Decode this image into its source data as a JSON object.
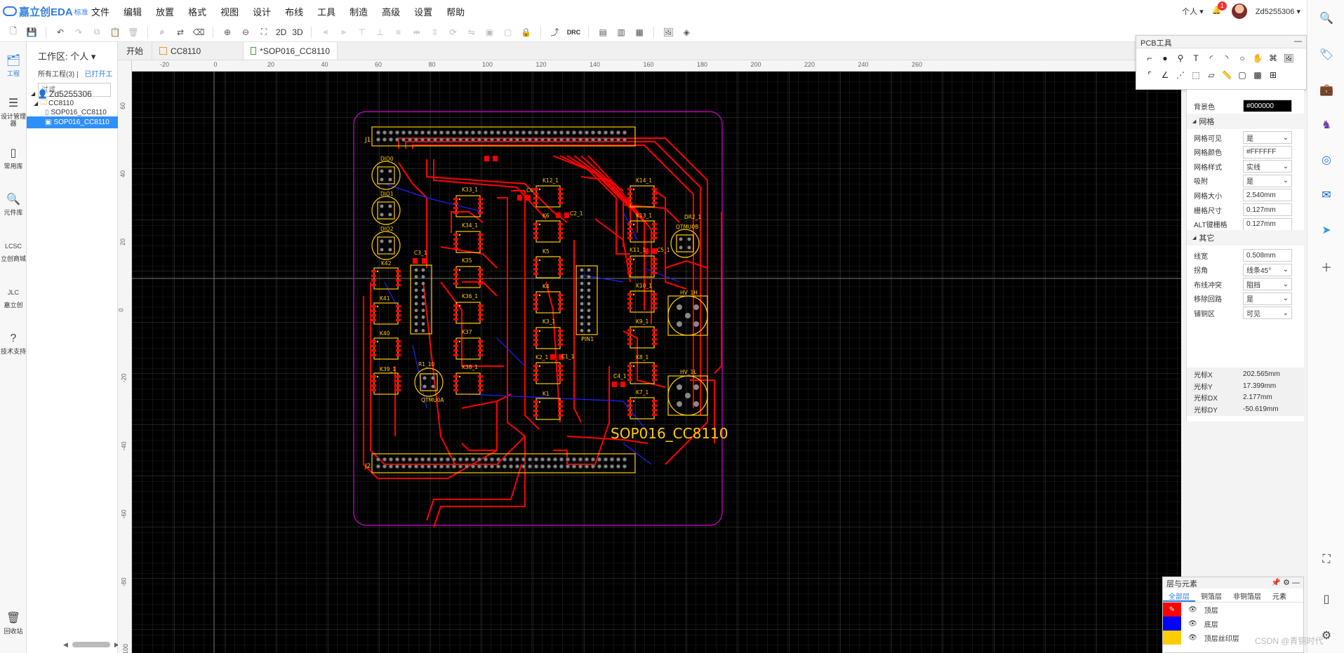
{
  "app": {
    "brand": "嘉立创EDA",
    "edition": "标准"
  },
  "menu": [
    "文件",
    "编辑",
    "放置",
    "格式",
    "视图",
    "设计",
    "布线",
    "工具",
    "制造",
    "高级",
    "设置",
    "帮助"
  ],
  "topright": {
    "mode": "个人",
    "notifications": "1",
    "username": "Zd5255306"
  },
  "toolbar": {
    "view2d": "2D",
    "view3d": "3D",
    "drc": "DRC"
  },
  "leftbar": [
    {
      "label": "工程",
      "icon": "folder-icon"
    },
    {
      "label": "设计管理器",
      "icon": "tree-icon"
    },
    {
      "label": "常用库",
      "icon": "chip-icon"
    },
    {
      "label": "元件库",
      "icon": "search-icon"
    },
    {
      "label": "立创商城",
      "icon": "lcsc-icon"
    },
    {
      "label": "嘉立创",
      "icon": "jlc-icon"
    },
    {
      "label": "技术支持",
      "icon": "help-icon"
    }
  ],
  "recycle": "回收站",
  "project": {
    "workspace": "工作区: 个人",
    "all_projects": "所有工程(3)",
    "opened": "已打开工",
    "filter_placeholder": "过滤",
    "tree": {
      "user": "Zd5255306",
      "project": "CC8110",
      "file1": "SOP016_CC8110",
      "file2": "SOP016_CC8110"
    }
  },
  "tabs": {
    "start": "开始",
    "t1": "CC8110",
    "t2": "*SOP016_CC8110"
  },
  "ruler": {
    "top": [
      "-20",
      "0",
      "20",
      "40",
      "60",
      "80",
      "100",
      "120",
      "140",
      "160",
      "180",
      "200",
      "220",
      "240",
      "260"
    ],
    "left": [
      "60",
      "40",
      "20",
      "0",
      "-20",
      "-40",
      "-60",
      "-80",
      "-100"
    ]
  },
  "pcb_tools": {
    "title": "PCB工具"
  },
  "properties": {
    "bg_label": "背景色",
    "bg_value": "#000000",
    "grid_section": "网格",
    "rows": [
      {
        "label": "网格可见",
        "value": "是"
      },
      {
        "label": "网格颜色",
        "value": "#FFFFFF"
      },
      {
        "label": "网格样式",
        "value": "实线"
      },
      {
        "label": "吸附",
        "value": "是"
      },
      {
        "label": "网格大小",
        "value": "2.540mm"
      },
      {
        "label": "栅格尺寸",
        "value": "0.127mm"
      },
      {
        "label": "ALT键栅格",
        "value": "0.127mm"
      }
    ],
    "other_section": "其它",
    "other_rows": [
      {
        "label": "线宽",
        "value": "0.508mm"
      },
      {
        "label": "拐角",
        "value": "线条45°"
      },
      {
        "label": "布线冲突",
        "value": "阻挡"
      },
      {
        "label": "移除回路",
        "value": "是"
      },
      {
        "label": "铺铜区",
        "value": "可见"
      }
    ],
    "cursor": [
      {
        "label": "光标X",
        "value": "202.565mm"
      },
      {
        "label": "光标Y",
        "value": "17.399mm"
      },
      {
        "label": "光标DX",
        "value": "2.177mm"
      },
      {
        "label": "光标DY",
        "value": "-50.619mm"
      }
    ]
  },
  "layers": {
    "title": "层与元素",
    "tabs": [
      "全部层",
      "铜箔层",
      "非铜箔层",
      "元素"
    ],
    "rows": [
      {
        "name": "顶层",
        "color": "#FF0000"
      },
      {
        "name": "底层",
        "color": "#0000FF"
      },
      {
        "name": "顶层丝印层",
        "color": "#FFCC00"
      }
    ]
  },
  "board": {
    "title": "SOP016_CC8110",
    "labels": {
      "j1": "J1",
      "j2": "J2",
      "dio0": "DIO0",
      "dio1": "DIO1",
      "dio2": "DIO2",
      "k42": "K42",
      "k41": "K41",
      "k40": "K40",
      "k39": "K39_1",
      "k33": "K33_1",
      "k34": "K34_1",
      "k35": "K35",
      "k36": "K36_1",
      "k37": "K37",
      "k38": "K38_1",
      "k12": "K12_1",
      "k6": "K6",
      "k5": "K5",
      "k4": "K4",
      "k3": "K3_1",
      "k2": "K2_1",
      "k1": "K1",
      "k14": "K14_1",
      "k13": "K13_1",
      "k11": "K11_1",
      "k10": "K10_1",
      "k9": "K9_1",
      "k8": "K8_1",
      "k7": "K7_1",
      "c1": "C1_1",
      "c2": "C2_1",
      "c3": "C3_1",
      "c4": "C4_1",
      "c5": "C5_1",
      "c6": "C6",
      "pin1": "PIN1",
      "qtmu0a": "QTMU0A",
      "qtmu0b": "QTMU0B",
      "r1": "R1_10",
      "dr2": "DR2_1",
      "hv1h": "HV_1H",
      "hv1l": "HV_1L"
    },
    "colors": {
      "outline": "#B400B4",
      "top": "#FF0000",
      "bottom": "#2020FF",
      "silk": "#FFCC00",
      "pad": "#888888"
    }
  },
  "watermark": "CSDN @青铜时代"
}
